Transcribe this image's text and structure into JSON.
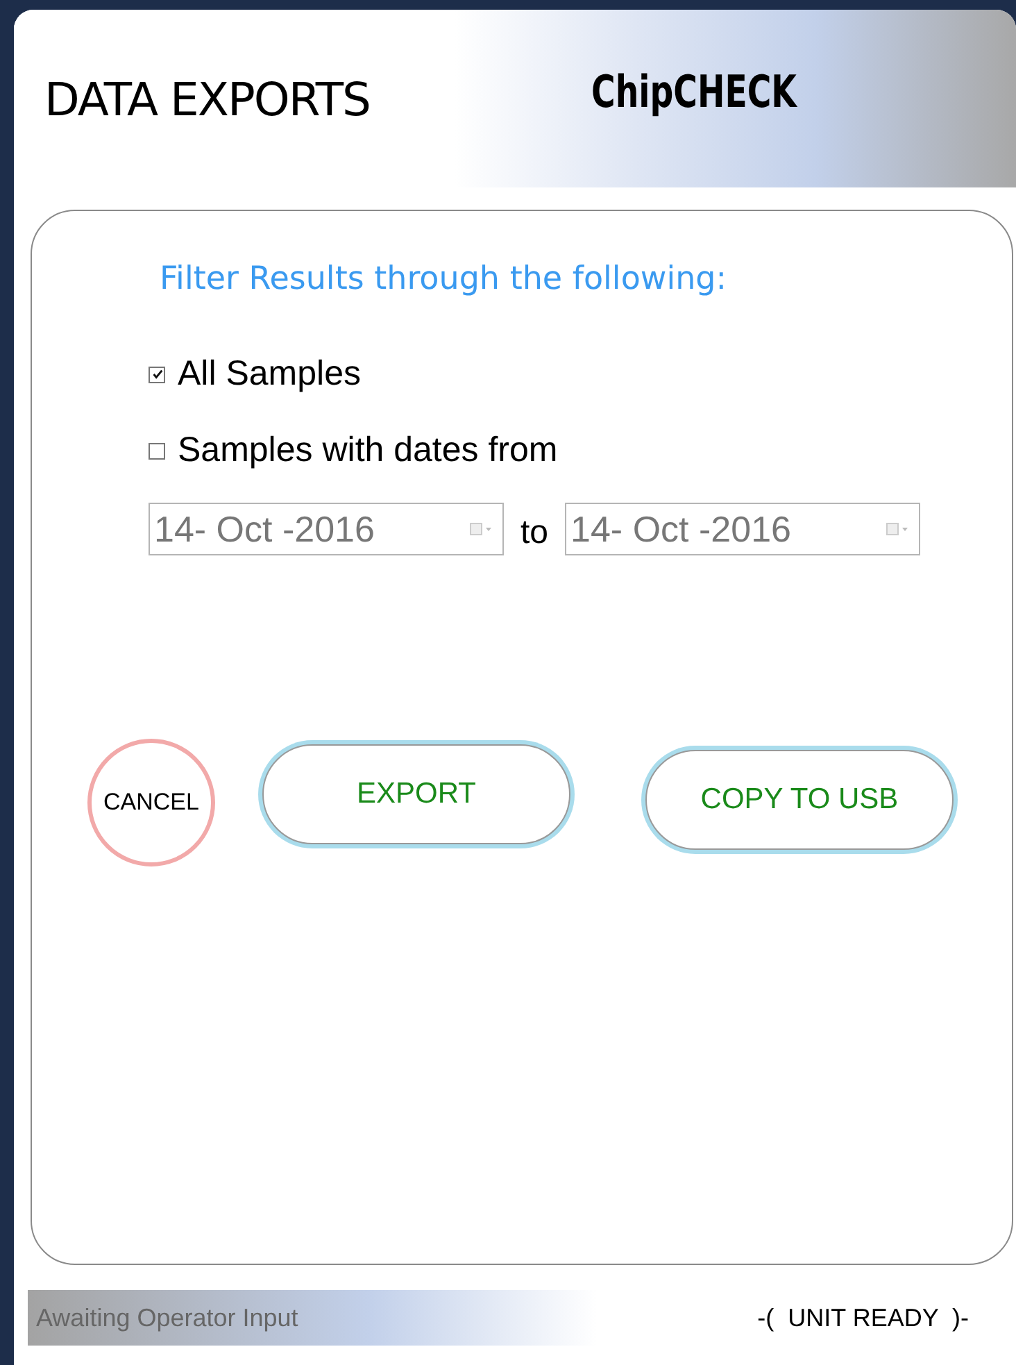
{
  "header": {
    "title": "DATA EXPORTS",
    "brand": "ChipCHECK"
  },
  "filter": {
    "heading": "Filter Results through the following:",
    "options": [
      {
        "label": "All Samples",
        "checked": true
      },
      {
        "label": "Samples with dates from",
        "checked": false
      }
    ],
    "date_from": "14- Oct -2016",
    "separator": "to",
    "date_to": "14- Oct -2016"
  },
  "buttons": [
    {
      "kind": "cancel",
      "label": "CANCEL"
    },
    {
      "kind": "action",
      "label": "EXPORT"
    },
    {
      "kind": "action",
      "label": "COPY TO USB"
    }
  ],
  "status_bar": {
    "message": "Awaiting Operator Input",
    "unit_status": "-(  UNIT READY  )-"
  }
}
